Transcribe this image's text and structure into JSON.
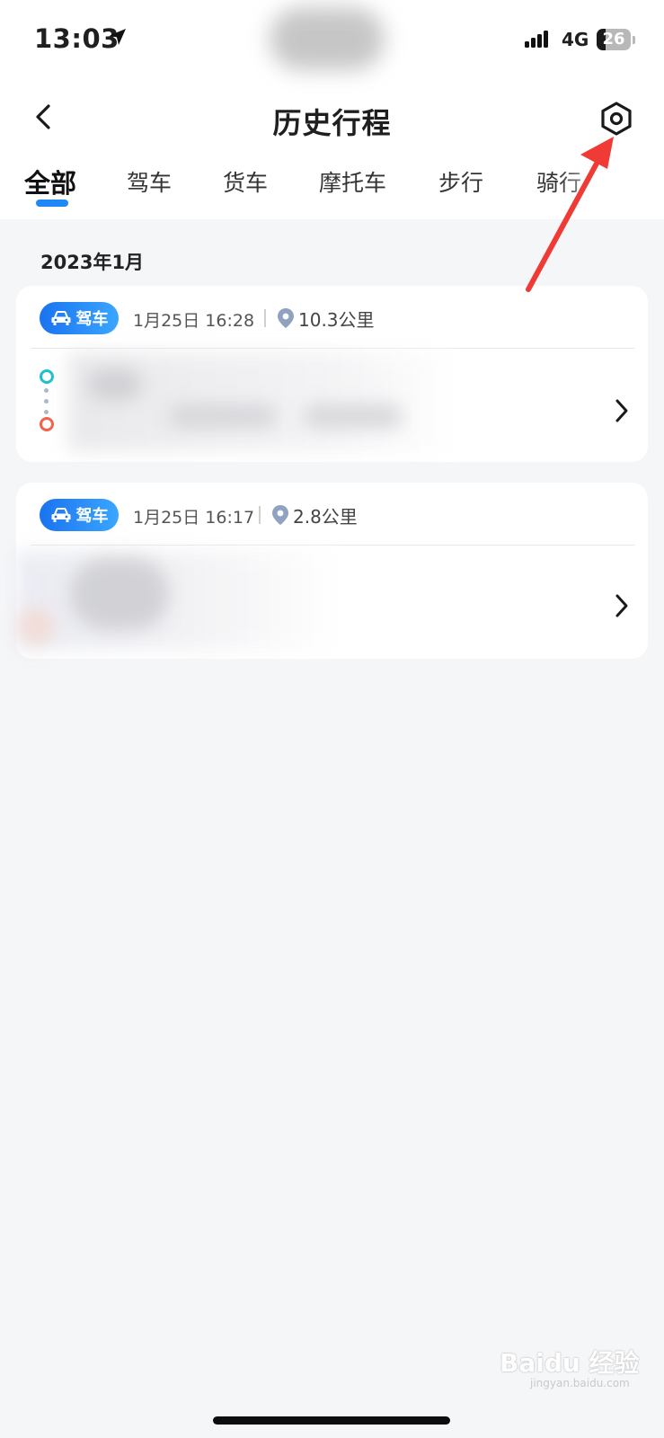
{
  "status_bar": {
    "time": "13:03",
    "network": "4G",
    "battery": "26"
  },
  "nav": {
    "title": "历史行程"
  },
  "tabs": [
    {
      "label": "全部",
      "active": true
    },
    {
      "label": "驾车",
      "active": false
    },
    {
      "label": "货车",
      "active": false
    },
    {
      "label": "摩托车",
      "active": false
    },
    {
      "label": "步行",
      "active": false
    },
    {
      "label": "骑行",
      "active": false
    }
  ],
  "list": {
    "month_header": "2023年1月",
    "trips": [
      {
        "mode": "驾车",
        "datetime": "1月25日 16:28",
        "distance": "10.3公里"
      },
      {
        "mode": "驾车",
        "datetime": "1月25日 16:17",
        "distance": "2.8公里"
      }
    ]
  },
  "watermark": {
    "text": "Baidu 经验",
    "url": "jingyan.baidu.com"
  },
  "colors": {
    "accent": "#1e88f5",
    "annotation_arrow": "#f03a36",
    "route_start": "#1fbfcf",
    "route_end": "#f0624d"
  }
}
